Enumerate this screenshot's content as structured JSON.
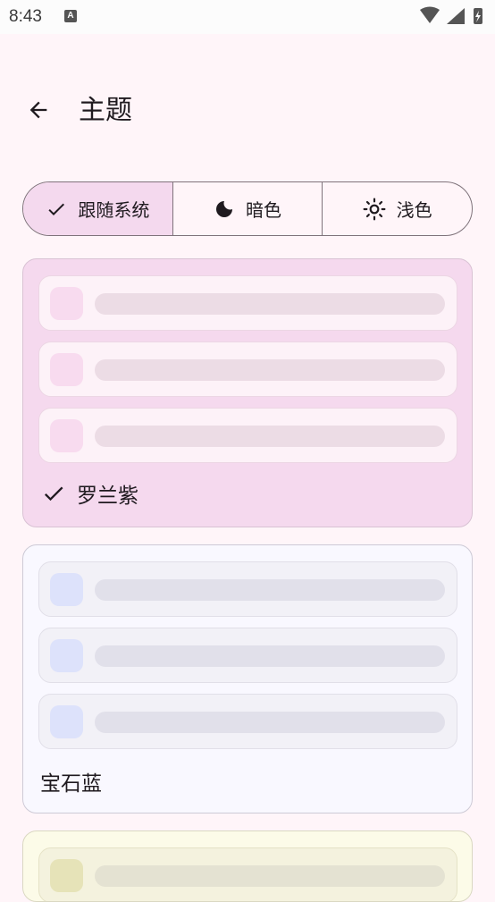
{
  "status_bar": {
    "time": "8:43",
    "notification_badge": "A"
  },
  "header": {
    "back_icon": "arrow-left-icon",
    "title": "主题"
  },
  "theme_mode": {
    "options": [
      {
        "label": "跟随系统",
        "icon": "check-icon",
        "selected": true
      },
      {
        "label": "暗色",
        "icon": "moon-icon",
        "selected": false
      },
      {
        "label": "浅色",
        "icon": "sun-icon",
        "selected": false
      }
    ]
  },
  "palettes": [
    {
      "name": "罗兰紫",
      "selected": true,
      "accent": "#f5d9ee"
    },
    {
      "name": "宝石蓝",
      "selected": false,
      "accent": "#dde2fb"
    },
    {
      "name": "",
      "selected": false,
      "accent": "#fcfbe8"
    }
  ]
}
